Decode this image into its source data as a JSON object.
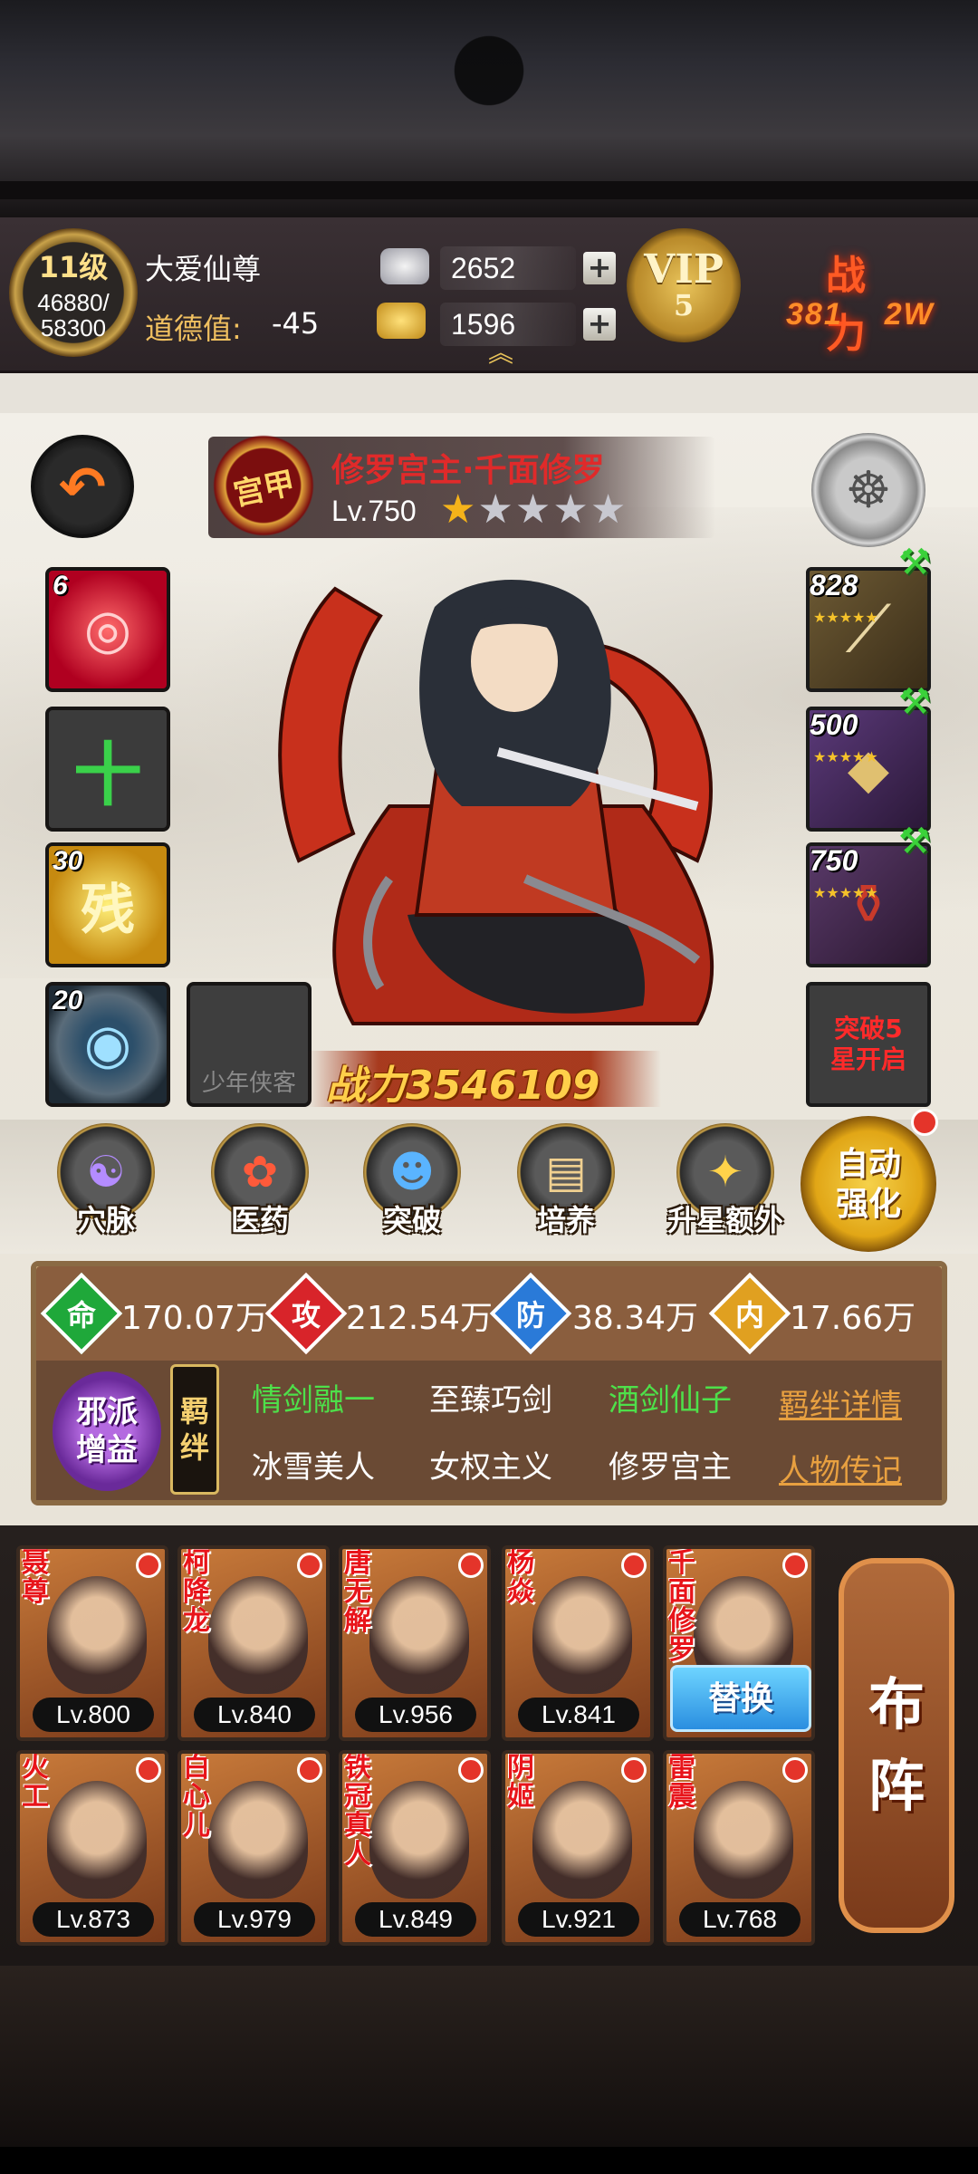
{
  "player": {
    "level": "11级",
    "exp": "46880/\n58300",
    "exp_current": "46880/",
    "exp_max": "58300",
    "name": "大爱仙尊",
    "morality_label": "道德值:",
    "morality_value": "-45"
  },
  "currency": {
    "silver": "2652",
    "gold": "1596"
  },
  "vip": {
    "label": "VIP",
    "level": "5"
  },
  "power_header": {
    "label": "战力",
    "value": "381",
    "value_suffix": "2W"
  },
  "hero": {
    "faction": "宫甲",
    "name": "修罗宫主·千面修罗",
    "level": "Lv.750",
    "stars_total": 5,
    "stars_lit": 1,
    "battle_power": "战力3546109"
  },
  "left_slots": [
    {
      "num": "6"
    },
    {
      "num": ""
    },
    {
      "num": "30",
      "glyph": "残"
    },
    {
      "num": "20"
    },
    {
      "num": "",
      "caption": "少年侠客"
    }
  ],
  "equipment": [
    {
      "num": "828"
    },
    {
      "num": "500"
    },
    {
      "num": "750"
    }
  ],
  "breakthrough_text": "突破5星开启",
  "breakthrough_line1": "突破5",
  "breakthrough_line2": "星开启",
  "functions": [
    {
      "label": "穴脉",
      "icon": "meridian-icon"
    },
    {
      "label": "医药",
      "icon": "medicine-icon"
    },
    {
      "label": "突破",
      "icon": "breakthrough-icon"
    },
    {
      "label": "培养",
      "icon": "cultivate-icon"
    },
    {
      "label": "升星额外",
      "icon": "star-up-icon"
    }
  ],
  "auto_strengthen": {
    "line1": "自动",
    "line2": "强化"
  },
  "stats": [
    {
      "icon": "命",
      "value": "170.07万",
      "color": "#1fa83a"
    },
    {
      "icon": "攻",
      "value": "212.54万",
      "color": "#d8242a"
    },
    {
      "icon": "防",
      "value": "38.34万",
      "color": "#2a7ad8"
    },
    {
      "icon": "内",
      "value": "17.66万",
      "color": "#e0a020"
    }
  ],
  "faction_bonus": {
    "line1": "邪派",
    "line2": "增益"
  },
  "bonds_tag": {
    "line1": "羁",
    "line2": "绊"
  },
  "bonds": [
    {
      "label": "情剑融一",
      "active": true
    },
    {
      "label": "至臻巧剑",
      "active": false
    },
    {
      "label": "酒剑仙子",
      "active": true
    },
    {
      "label": "冰雪美人",
      "active": false
    },
    {
      "label": "女权主义",
      "active": false
    },
    {
      "label": "修罗宫主",
      "active": false
    }
  ],
  "links": {
    "bond_details": "羁绊详情",
    "biography": "人物传记"
  },
  "team": [
    {
      "name": "聂尊",
      "level": "Lv.800"
    },
    {
      "name": "柯降龙",
      "level": "Lv.840"
    },
    {
      "name": "唐无解",
      "level": "Lv.956"
    },
    {
      "name": "杨焱",
      "level": "Lv.841"
    },
    {
      "name": "千面修罗",
      "level": "",
      "replace": "替换"
    },
    {
      "name": "火工",
      "level": "Lv.873"
    },
    {
      "name": "白心儿",
      "level": "Lv.979"
    },
    {
      "name": "铁冠真人",
      "level": "Lv.849"
    },
    {
      "name": "阴姬",
      "level": "Lv.921"
    },
    {
      "name": "雷震",
      "level": "Lv.768"
    }
  ],
  "formation": {
    "line1": "布",
    "line2": "阵"
  }
}
